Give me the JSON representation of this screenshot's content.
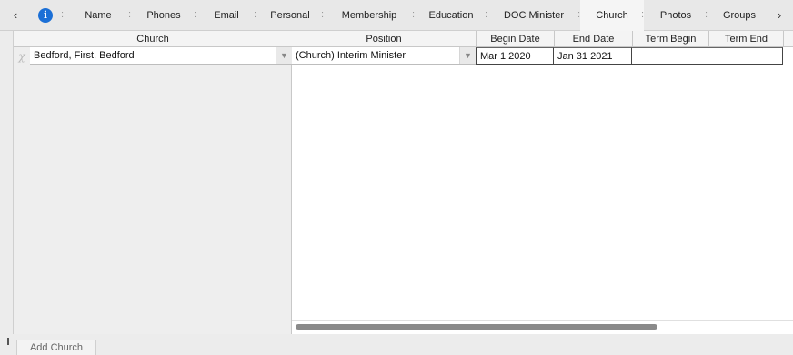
{
  "tabs": {
    "prev_arrow": "‹",
    "next_arrow": "›",
    "info_glyph": "i",
    "separator": ":",
    "items": [
      {
        "label": "Name"
      },
      {
        "label": "Phones"
      },
      {
        "label": "Email"
      },
      {
        "label": "Personal"
      },
      {
        "label": "Membership"
      },
      {
        "label": "Education"
      },
      {
        "label": "DOC Minister"
      },
      {
        "label": "Church"
      },
      {
        "label": "Photos"
      },
      {
        "label": "Groups"
      }
    ],
    "active": "Church"
  },
  "grid": {
    "columns": {
      "church": "Church",
      "position": "Position",
      "begin_date": "Begin Date",
      "end_date": "End Date",
      "term_begin": "Term Begin",
      "term_end": "Term End"
    },
    "rows": [
      {
        "marker": "χ",
        "church": "Bedford, First, Bedford",
        "position": "(Church) Interim Minister",
        "begin_date": "Mar 1 2020",
        "end_date": "Jan 31 2021",
        "term_begin": "",
        "term_end": ""
      }
    ]
  },
  "footer": {
    "add_button": "Add Church"
  },
  "icons": {
    "info": "info-icon",
    "prev": "chevron-left-icon",
    "next": "chevron-right-icon",
    "dropdown": "chevron-down-icon"
  },
  "colors": {
    "info_blue": "#1b6fd6"
  }
}
